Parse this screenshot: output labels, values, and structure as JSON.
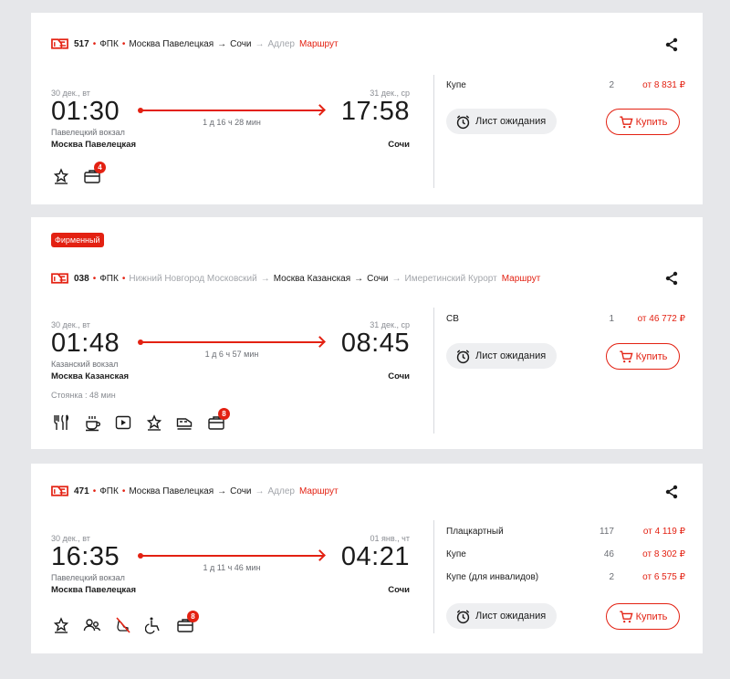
{
  "trains": [
    {
      "number": "517",
      "carrier": "ФПК",
      "route_from": "Москва Павелецкая",
      "route_to": "Сочи",
      "route_end": "Адлер",
      "route_link": "Маршрут",
      "dep_date": "30 дек., вт",
      "dep_time": "01:30",
      "arr_date": "31 дек., ср",
      "arr_time": "17:58",
      "duration": "1 д 16 ч 28 мин",
      "dep_vokzal": "Павелецкий вокзал",
      "dep_station": "Москва Павелецкая",
      "arr_station": "Сочи",
      "luggage_count": "4",
      "seats": [
        {
          "class": "Купе",
          "qty": "2",
          "price": "от 8 831 ₽"
        }
      ],
      "wait_label": "Лист ожидания",
      "buy_label": "Купить"
    },
    {
      "badge": "Фирменный",
      "number": "038",
      "carrier": "ФПК",
      "route_start": "Нижний Новгород Московский",
      "route_from": "Москва Казанская",
      "route_to": "Сочи",
      "route_end": "Имеретинский Курорт",
      "route_link": "Маршрут",
      "dep_date": "30 дек., вт",
      "dep_time": "01:48",
      "arr_date": "31 дек., ср",
      "arr_time": "08:45",
      "duration": "1 д 6 ч 57 мин",
      "dep_vokzal": "Казанский вокзал",
      "dep_station": "Москва Казанская",
      "arr_station": "Сочи",
      "stop": "Стоянка : 48 мин",
      "luggage_count": "8",
      "seats": [
        {
          "class": "СВ",
          "qty": "1",
          "price": "от 46 772 ₽"
        }
      ],
      "wait_label": "Лист ожидания",
      "buy_label": "Купить"
    },
    {
      "number": "471",
      "carrier": "ФПК",
      "route_from": "Москва Павелецкая",
      "route_to": "Сочи",
      "route_end": "Адлер",
      "route_link": "Маршрут",
      "dep_date": "30 дек., вт",
      "dep_time": "16:35",
      "arr_date": "01 янв., чт",
      "arr_time": "04:21",
      "duration": "1 д 11 ч 46 мин",
      "dep_vokzal": "Павелецкий вокзал",
      "dep_station": "Москва Павелецкая",
      "arr_station": "Сочи",
      "luggage_count": "8",
      "seats": [
        {
          "class": "Плацкартный",
          "qty": "117",
          "price": "от 4 119 ₽"
        },
        {
          "class": "Купе",
          "qty": "46",
          "price": "от 8 302 ₽"
        },
        {
          "class": "Купе (для инвалидов)",
          "qty": "2",
          "price": "от 6 575 ₽"
        }
      ],
      "wait_label": "Лист ожидания",
      "buy_label": "Купить"
    }
  ],
  "icons": {
    "brand": "rzd-logo-icon",
    "share": "share-icon",
    "alarm": "alarm-clock-icon",
    "cart": "cart-icon"
  },
  "colors": {
    "accent": "#e32112",
    "background": "#e6e7ea",
    "card": "#ffffff",
    "muted": "#8a8d93"
  }
}
